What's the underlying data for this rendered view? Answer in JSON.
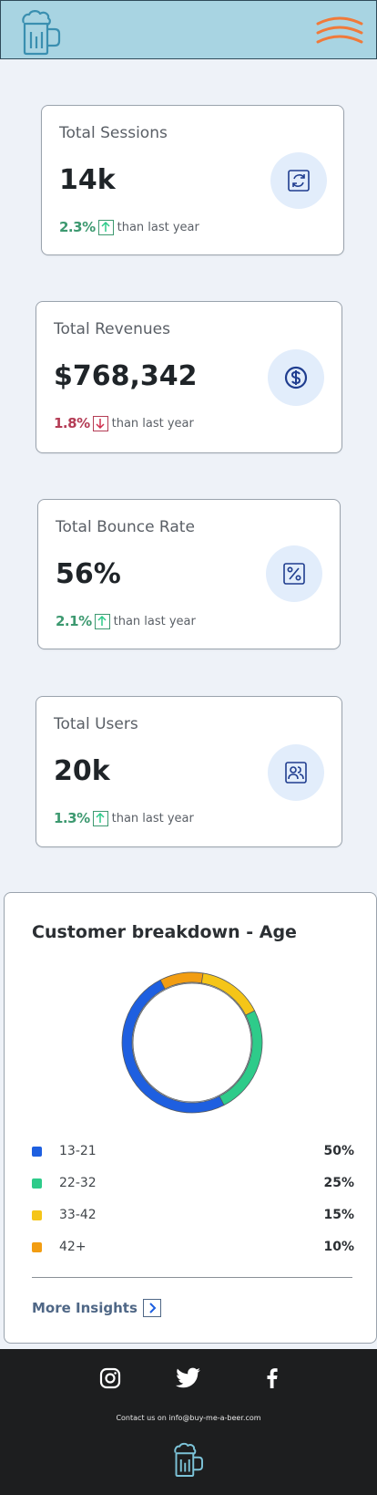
{
  "header": {
    "logo_icon": "beer-mug-icon",
    "menu_icon": "hamburger-menu-icon",
    "colors": {
      "background": "#a8d4e2",
      "logo": "#3a8fb0",
      "menu": "#f07a3a"
    }
  },
  "stats": [
    {
      "title": "Total Sessions",
      "value": "14k",
      "change": "2.3%",
      "direction": "up",
      "comparison": "than last year",
      "icon": "refresh-icon"
    },
    {
      "title": "Total Revenues",
      "value": "$768,342",
      "change": "1.8%",
      "direction": "down",
      "comparison": "than last year",
      "icon": "dollar-icon"
    },
    {
      "title": "Total Bounce Rate",
      "value": "56%",
      "change": "2.1%",
      "direction": "up",
      "comparison": "than last year",
      "icon": "percent-icon"
    },
    {
      "title": "Total Users",
      "value": "20k",
      "change": "1.3%",
      "direction": "up",
      "comparison": "than last year",
      "icon": "users-icon"
    }
  ],
  "breakdown": {
    "title": "Customer breakdown - Age",
    "legend": [
      {
        "label": "13-21",
        "value": "50%"
      },
      {
        "label": "22-32",
        "value": "25%"
      },
      {
        "label": "33-42",
        "value": "15%"
      },
      {
        "label": "42+",
        "value": "10%"
      }
    ],
    "more_label": "More Insights"
  },
  "chart_data": {
    "type": "pie",
    "title": "",
    "categories": [
      "13-21",
      "22-32",
      "33-42",
      "42+"
    ],
    "values": [
      50,
      25,
      15,
      10
    ],
    "colors": [
      "#1e5fe0",
      "#2ecb8a",
      "#f5c518",
      "#f29d12"
    ]
  },
  "footer": {
    "contact": "Contact us on info@buy-me-a-beer.com",
    "social_icons": [
      "instagram-icon",
      "twitter-icon",
      "facebook-icon"
    ],
    "logo_icon": "beer-mug-icon"
  }
}
